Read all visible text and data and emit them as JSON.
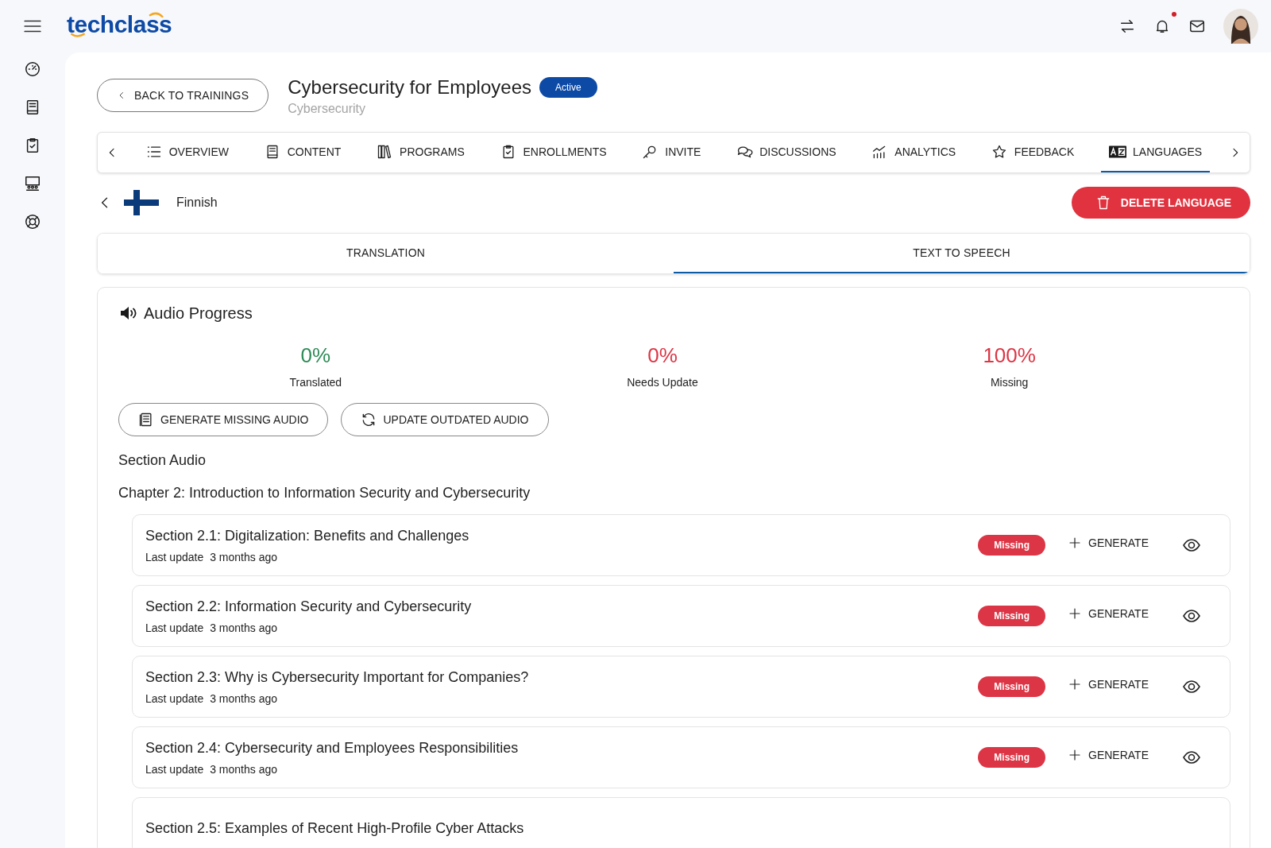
{
  "header": {
    "logo": "techclass",
    "notification_unread": true
  },
  "training": {
    "back_button": "BACK TO TRAININGS",
    "title": "Cybersecurity for Employees",
    "status": "Active",
    "category": "Cybersecurity"
  },
  "tabs": [
    {
      "label": "OVERVIEW",
      "selected": false
    },
    {
      "label": "CONTENT",
      "selected": false
    },
    {
      "label": "PROGRAMS",
      "selected": false
    },
    {
      "label": "ENROLLMENTS",
      "selected": false
    },
    {
      "label": "INVITE",
      "selected": false
    },
    {
      "label": "DISCUSSIONS",
      "selected": false
    },
    {
      "label": "ANALYTICS",
      "selected": false
    },
    {
      "label": "FEEDBACK",
      "selected": false
    },
    {
      "label": "LANGUAGES",
      "selected": true
    }
  ],
  "language": {
    "name": "Finnish",
    "delete_button": "DELETE LANGUAGE"
  },
  "subtabs": [
    {
      "label": "TRANSLATION",
      "selected": false
    },
    {
      "label": "TEXT TO SPEECH",
      "selected": true
    }
  ],
  "audio_progress": {
    "title": "Audio Progress",
    "stats": [
      {
        "value": "0%",
        "label": "Translated",
        "color": "#2e8b57"
      },
      {
        "value": "0%",
        "label": "Needs Update",
        "color": "#dc3545"
      },
      {
        "value": "100%",
        "label": "Missing",
        "color": "#dc3545"
      }
    ],
    "buttons": [
      {
        "label": "GENERATE MISSING AUDIO"
      },
      {
        "label": "UPDATE OUTDATED AUDIO"
      }
    ]
  },
  "section_audio": {
    "heading": "Section Audio",
    "chapter": "Chapter 2: Introduction to Information Security and Cybersecurity",
    "sections": [
      {
        "title": "Section 2.1: Digitalization: Benefits and Challenges",
        "last_update_label": "Last update",
        "last_update": "3 months ago",
        "status": "Missing",
        "action": "GENERATE"
      },
      {
        "title": "Section 2.2: Information Security and Cybersecurity",
        "last_update_label": "Last update",
        "last_update": "3 months ago",
        "status": "Missing",
        "action": "GENERATE"
      },
      {
        "title": "Section 2.3: Why is Cybersecurity Important for Companies?",
        "last_update_label": "Last update",
        "last_update": "3 months ago",
        "status": "Missing",
        "action": "GENERATE"
      },
      {
        "title": "Section 2.4: Cybersecurity and Employees Responsibilities",
        "last_update_label": "Last update",
        "last_update": "3 months ago",
        "status": "Missing",
        "action": "GENERATE"
      },
      {
        "title": "Section 2.5: Examples of Recent High-Profile Cyber Attacks"
      }
    ]
  }
}
